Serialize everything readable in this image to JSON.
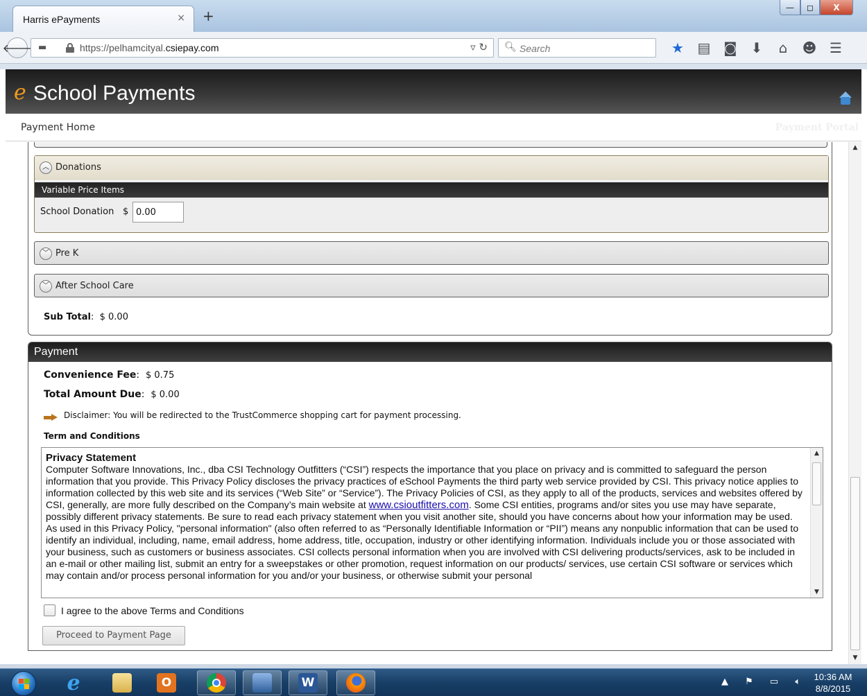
{
  "browser": {
    "tab_title": "Harris ePayments",
    "tab_close": "×",
    "new_tab": "+",
    "window_buttons": {
      "minimize": "—",
      "maximize": "◻",
      "close": "X"
    },
    "url_prefix": "https://pelhamcityal.",
    "url_domain": "csiepay.com",
    "search_placeholder": "Search",
    "toolbar_icons": [
      "star-icon",
      "reading-list-icon",
      "pocket-icon",
      "download-icon",
      "home-icon",
      "chat-icon",
      "menu-icon"
    ]
  },
  "site": {
    "logo_e": "e",
    "logo_text": "School Payments",
    "nav_link": "Payment Home",
    "nav_right": "Payment Portal"
  },
  "cart": {
    "sections": [
      {
        "title": "Donations",
        "expanded": true
      },
      {
        "title": "Pre K",
        "expanded": false
      },
      {
        "title": "After School Care",
        "expanded": false
      }
    ],
    "variable_price_header": "Variable Price Items",
    "donation_label": "School Donation",
    "currency": "$",
    "donation_value": "0.00",
    "subtotal_label": "Sub Total",
    "subtotal_value": "$ 0.00"
  },
  "payment": {
    "header": "Payment",
    "convenience_fee_label": "Convenience Fee",
    "convenience_fee_value": "$ 0.75",
    "total_label": "Total Amount Due",
    "total_value": "$ 0.00",
    "disclaimer": "Disclaimer:  You will be redirected to the TrustCommerce shopping cart for payment processing.",
    "terms_title": "Term and Conditions",
    "privacy_title": "Privacy Statement",
    "privacy_p1_a": "Computer Software Innovations, Inc., dba CSI Technology Outfitters (“CSI”) respects the importance that you place on privacy and is committed to safeguard the person information that you provide. This Privacy Policy discloses the privacy practices of eSchool Payments the third party web service provided by CSI. This privacy notice applies to information collected by this web site and its services (“Web Site” or “Service”). The Privacy Policies of CSI, as they apply to all of the products, services and websites offered by CSI, generally, are more fully described on the Company’s main website at ",
    "privacy_link": "www.csioutfitters.com",
    "privacy_p1_b": ". Some CSI entities, programs and/or sites you use may have separate, possibly different privacy statements. Be sure to read each privacy statement when you visit another site, should you have concerns about how your information may be used.",
    "privacy_p2": "As used in this Privacy Policy, \"personal information\" (also often referred to as “Personally Identifiable Information or “PII”) means any nonpublic information that can be used to identify an individual, including, name, email address, home address, title, occupation, industry or other identifying information. Individuals include you or those associated with your business, such as customers or business associates. CSI collects personal information when you are involved with CSI delivering products/services, ask to be included in an e-mail or other mailing list, submit an entry for a sweepstakes or other promotion, request information on our products/ services, use certain CSI software or services which may contain and/or process personal information for you and/or your business, or otherwise submit your personal",
    "agree_label": "I agree to the above Terms and Conditions",
    "agree_checked": false,
    "proceed_button": "Proceed to Payment Page"
  },
  "taskbar": {
    "apps": [
      "internet-explorer",
      "file-explorer",
      "outlook",
      "chrome",
      "remote-desktop",
      "word",
      "firefox"
    ],
    "active_app": "firefox",
    "time": "10:36 AM",
    "date": "8/8/2015"
  },
  "colors": {
    "header_dark": "#2a2a2a",
    "logo_orange": "#f39a1c",
    "accordion_open_border": "#8a7d5a",
    "link_blue": "#1a0dab",
    "arrow_orange": "#b9751c",
    "taskbar_blue": "#183f66"
  }
}
